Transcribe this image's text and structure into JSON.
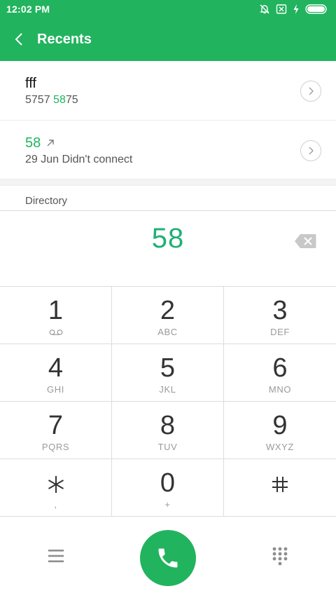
{
  "status": {
    "time": "12:02 PM"
  },
  "app_bar": {
    "title": "Recents"
  },
  "recents": [
    {
      "name": "fff",
      "number_prefix": "5757 ",
      "number_match": "58",
      "number_suffix": "75"
    },
    {
      "name": "58",
      "detail": "29 Jun Didn't connect"
    }
  ],
  "section": {
    "header": "Directory"
  },
  "dialer": {
    "digits": "58"
  },
  "keypad": [
    {
      "num": "1",
      "letters": ""
    },
    {
      "num": "2",
      "letters": "ABC"
    },
    {
      "num": "3",
      "letters": "DEF"
    },
    {
      "num": "4",
      "letters": "GHI"
    },
    {
      "num": "5",
      "letters": "JKL"
    },
    {
      "num": "6",
      "letters": "MNO"
    },
    {
      "num": "7",
      "letters": "PQRS"
    },
    {
      "num": "8",
      "letters": "TUV"
    },
    {
      "num": "9",
      "letters": "WXYZ"
    },
    {
      "num": "",
      "letters": ","
    },
    {
      "num": "0",
      "letters": "+"
    },
    {
      "num": "",
      "letters": ""
    }
  ],
  "colors": {
    "brand_green": "#22b35e",
    "digit_green": "#1fb075"
  },
  "icons": [
    "back-arrow-icon",
    "bell-off-icon",
    "sim-x-icon",
    "charging-bolt-icon",
    "battery-icon",
    "chevron-right-icon",
    "outgoing-call-arrow-icon",
    "backspace-icon",
    "voicemail-icon",
    "asterisk-icon",
    "hash-icon",
    "menu-icon",
    "phone-icon",
    "dialpad-icon"
  ]
}
